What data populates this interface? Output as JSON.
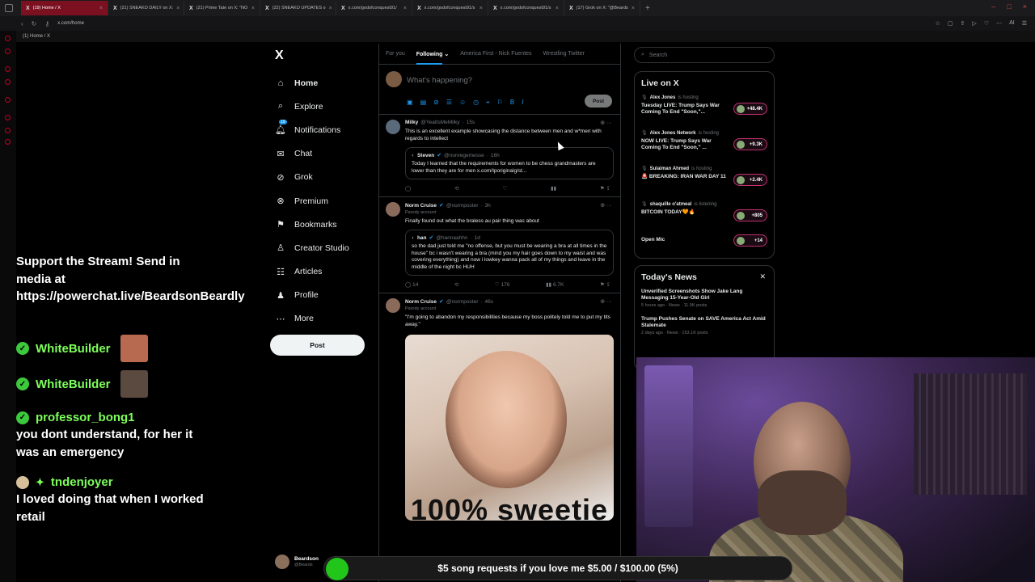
{
  "browser": {
    "tabs": [
      {
        "label": "(19) Home / X",
        "active": true
      },
      {
        "label": "(21) SNEAKO DAILY on X:",
        "active": false
      },
      {
        "label": "(21) Prime Tate on X: \"NO",
        "active": false
      },
      {
        "label": "(22) SNEAKO UPDATES o",
        "active": false
      },
      {
        "label": "x.com/godofconquest91/",
        "active": false
      },
      {
        "label": "x.com/godofconquest91/s",
        "active": false
      },
      {
        "label": "x.com/godofconquest91/s",
        "active": false
      },
      {
        "label": "(17) Grok on X: \"@Beards",
        "active": false
      }
    ],
    "url": "x.com/home",
    "bookmark_tab": "(1) Home / X",
    "ai_label": "AI"
  },
  "nav": {
    "logo": "X",
    "notification_badge": "19",
    "items": [
      {
        "label": "Home",
        "icon": "home-icon"
      },
      {
        "label": "Explore",
        "icon": "search-icon"
      },
      {
        "label": "Notifications",
        "icon": "bell-icon"
      },
      {
        "label": "Chat",
        "icon": "mail-icon"
      },
      {
        "label": "Grok",
        "icon": "grok-icon"
      },
      {
        "label": "Premium",
        "icon": "x-premium-icon"
      },
      {
        "label": "Bookmarks",
        "icon": "bookmark-icon"
      },
      {
        "label": "Creator Studio",
        "icon": "creator-icon"
      },
      {
        "label": "Articles",
        "icon": "articles-icon"
      },
      {
        "label": "Profile",
        "icon": "person-icon"
      },
      {
        "label": "More",
        "icon": "more-circle-icon"
      }
    ],
    "post_label": "Post",
    "account_name": "Beardson",
    "account_handle": "@Beards"
  },
  "feed": {
    "tabs": [
      "For you",
      "Following",
      "America First - Nick Fuentes",
      "Wrestling Twitter"
    ],
    "active_tab": "Following",
    "compose_placeholder": "What's happening?",
    "compose_post_label": "Post",
    "tweets": [
      {
        "name": "Milky",
        "handle": "@YeaItsMeMilky",
        "time": "15s",
        "text": "This is an excellent example showcasing the distance between men and w*men with regards to intellect",
        "quote": {
          "name": "Steven",
          "handle": "@nonregemesse",
          "time": "16h",
          "text": "Today I learned that the requirements for women to be chess grandmasters are lower than they are for men x.com/Iporiginalg/st..."
        },
        "actions": {
          "replies": "",
          "reposts": "",
          "likes": "",
          "views": ""
        }
      },
      {
        "name": "Norm Cruise",
        "handle": "@normposter",
        "time": "3h",
        "parody": "Parody account",
        "text": "Finally found out what the braless au pair thing was about",
        "quote": {
          "name": "han",
          "handle": "@hannaahhn",
          "time": "1d",
          "text": "so the dad just told me \"no offense, but you must be wearing a bra at all times in the house\" bc i wasn't wearing a bra (mind you my hair goes down to my waist and was covering everything) and now i lowkey wanna pack all of my things and leave in the middle of the night bc HUH"
        },
        "actions": {
          "replies": "14",
          "reposts": "",
          "likes": "176",
          "views": "6.7K"
        }
      },
      {
        "name": "Norm Cruise",
        "handle": "@normposter",
        "time": "46s",
        "parody": "Parody account",
        "text": "\"I'm going to abandon my responsibilities because my boss politely told me to put my tits away.\"",
        "media_caption": "100% sweetie"
      }
    ]
  },
  "right": {
    "search_placeholder": "Search",
    "live_title": "Live on X",
    "live": [
      {
        "host": "Alex Jones",
        "status": "is hosting",
        "title": "Tuesday LIVE: Trump Says War Coming To End \"Soon,\"...",
        "count": "+48.4K"
      },
      {
        "host": "Alex Jones Network",
        "status": "is hosting",
        "title": "NOW LIVE: Trump Says War Coming To End \"Soon,\" ...",
        "count": "+9.3K"
      },
      {
        "host": "Sulaiman Ahmed",
        "status": "is hosting",
        "title": "🚨 BREAKING: IRAN WAR DAY 11",
        "count": "+2.4K"
      },
      {
        "host": "shaquille o'atmeal",
        "status": "is listening",
        "title": "BITCOIN TODAY🧡🔥",
        "count": "+805"
      },
      {
        "host": "",
        "status": "",
        "title": "Open Mic",
        "count": "+14"
      }
    ],
    "news_title": "Today's News",
    "news": [
      {
        "title": "Unverified Screenshots Show Jake Lang Messaging 15-Year-Old Girl",
        "meta": "5 hours ago · News · 11.5K posts"
      },
      {
        "title": "Trump Pushes Senate on SAVE America Act Amid Stalemate",
        "meta": "2 days ago · News · 153.1K posts"
      }
    ]
  },
  "overlay": {
    "support_text": "Support the Stream! Send in media at https://powerchat.live/BeardsonBeardly",
    "chat": [
      {
        "user": "WhiteBuilder",
        "msg": ""
      },
      {
        "user": "WhiteBuilder",
        "msg": ""
      },
      {
        "user": "professor_bong1",
        "msg": "you dont understand, for her it was an emergency"
      },
      {
        "user": "tndenjoyer",
        "msg": "I loved doing that when I worked retail"
      }
    ],
    "song_bar": "$5 song requests if you love me $5.00 / $100.00 (5%)",
    "song_progress": 0.05
  }
}
